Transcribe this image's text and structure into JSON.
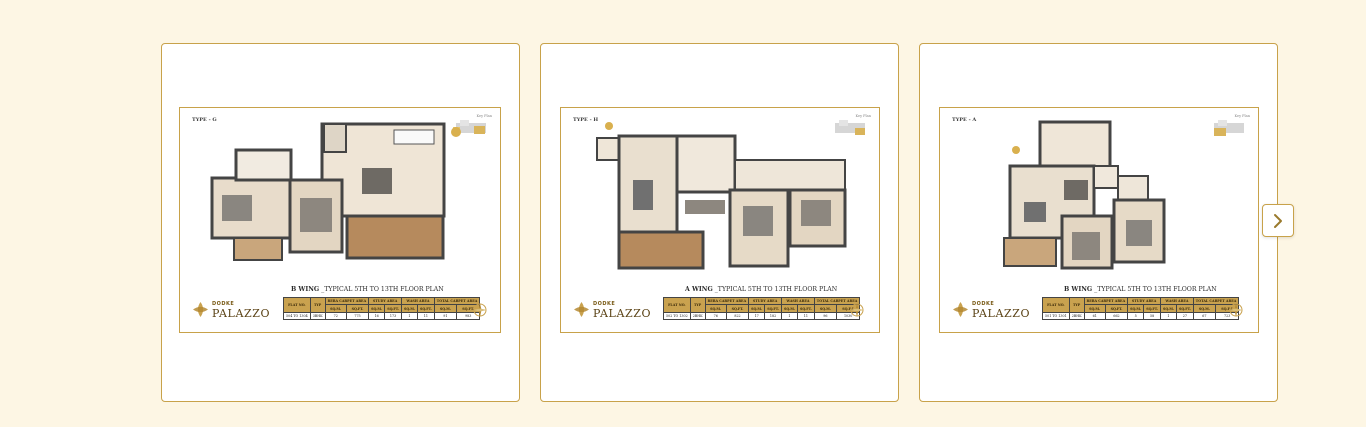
{
  "cards": [
    {
      "type_label": "TYPE - G",
      "keyplan_label": "Key Plan",
      "caption_wing": "B WING",
      "caption_rest": " _TYPICAL 5TH TO 13TH FLOOR PLAN",
      "brand_top": "DODKE",
      "brand_main": "PALAZZO",
      "headers": [
        "FLAT NO.",
        "TYP",
        "RERA CARPET AREA",
        "STUDY AREA",
        "WASH AREA",
        "TOTAL CARPET AREA"
      ],
      "units": [
        "SQ.M.",
        "SQ.FT.",
        "SQ.M.",
        "SQ.FT.",
        "SQ.M.",
        "SQ.FT.",
        "SQ.M.",
        "SQ.FT."
      ],
      "row": [
        "504 TO 1304",
        "3BHK",
        "72",
        "775",
        "16",
        "173",
        "1",
        "11",
        "91",
        "983"
      ]
    },
    {
      "type_label": "TYPE - H",
      "keyplan_label": "Key Plan",
      "caption_wing": "A WING",
      "caption_rest": " _TYPICAL 5TH TO 13TH FLOOR PLAN",
      "brand_top": "DODKE",
      "brand_main": "PALAZZO",
      "headers": [
        "FLAT NO.",
        "TYP",
        "RERA CARPET AREA",
        "STUDY AREA",
        "WASH AREA",
        "TOTAL CARPET AREA"
      ],
      "units": [
        "SQ.M.",
        "SQ.FT.",
        "SQ.M.",
        "SQ.FT.",
        "SQ.M.",
        "SQ.FT.",
        "SQ.M.",
        "SQ.FT."
      ],
      "row": [
        "502 TO 1302",
        "2BHK",
        "76",
        "822",
        "17",
        "182",
        "1",
        "11",
        "96",
        "1030"
      ]
    },
    {
      "type_label": "TYPE - A",
      "keyplan_label": "Key Plan",
      "caption_wing": "B WING",
      "caption_rest": " _TYPICAL 5TH TO 13TH FLOOR PLAN",
      "brand_top": "DODKE",
      "brand_main": "PALAZZO",
      "headers": [
        "FLAT NO.",
        "TYP",
        "RERA CARPET AREA",
        "STUDY AREA",
        "WASH AREA",
        "TOTAL CARPET AREA"
      ],
      "units": [
        "SQ.M.",
        "SQ.FT.",
        "SQ.M.",
        "SQ.FT.",
        "SQ.M.",
        "SQ.FT.",
        "SQ.M.",
        "SQ.FT."
      ],
      "row": [
        "501 TO 1301",
        "2BHK",
        "61",
        "662",
        "5",
        "58",
        "1",
        "27",
        "67",
        "723"
      ]
    }
  ],
  "colors": {
    "background": "#fdf6e4",
    "accent": "#c8a24a",
    "table_header": "#c9a24f"
  },
  "icons": {
    "next": "chevron-right-icon",
    "compass": "compass-icon",
    "logo": "palazzo-logo-icon"
  }
}
